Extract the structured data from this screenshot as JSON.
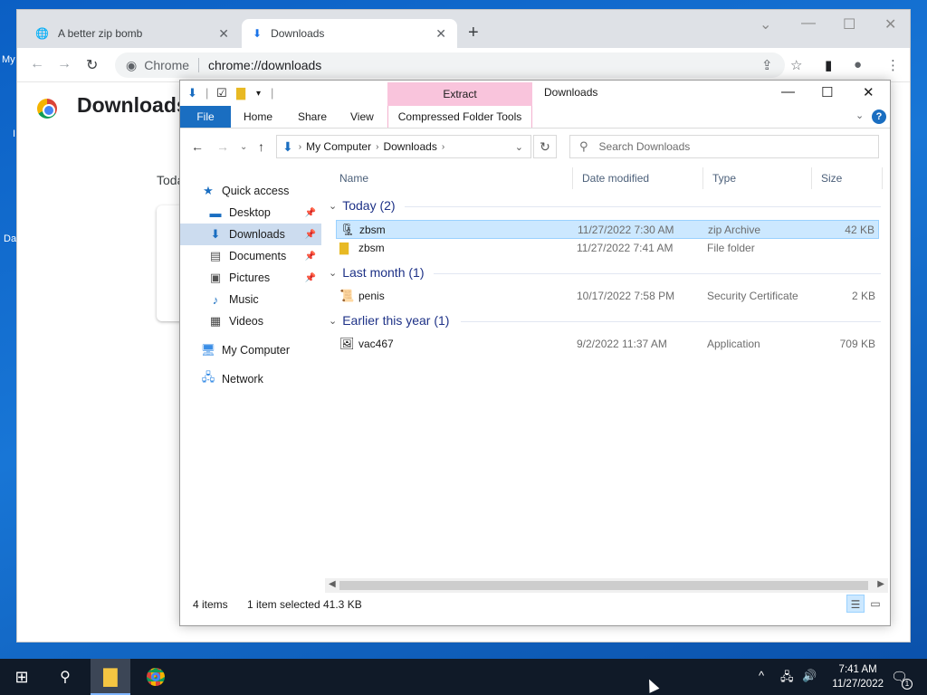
{
  "desktop": {
    "frag1": "My",
    "frag2": "Da"
  },
  "chrome": {
    "tabs": [
      {
        "title": "A better zip bomb",
        "icon": "globe-icon"
      },
      {
        "title": "Downloads",
        "icon": "download-icon"
      }
    ],
    "omnibox_chip": "Chrome",
    "url": "chrome://downloads",
    "page_title": "Downloads",
    "today_fragment": "Toda"
  },
  "explorer": {
    "title": "Downloads",
    "context_group": "Extract",
    "ribbon_tabs": {
      "file": "File",
      "home": "Home",
      "share": "Share",
      "view": "View",
      "context": "Compressed Folder Tools"
    },
    "breadcrumb": [
      "My Computer",
      "Downloads"
    ],
    "search_placeholder": "Search Downloads",
    "nav": {
      "quick_access": "Quick access",
      "desktop": "Desktop",
      "downloads": "Downloads",
      "documents": "Documents",
      "pictures": "Pictures",
      "music": "Music",
      "videos": "Videos",
      "my_computer": "My Computer",
      "network": "Network"
    },
    "columns": {
      "name": "Name",
      "date": "Date modified",
      "type": "Type",
      "size": "Size"
    },
    "groups": [
      {
        "label": "Today (2)",
        "files": [
          {
            "name": "zbsm",
            "date": "11/27/2022 7:30 AM",
            "type": "zip Archive",
            "size": "42 KB",
            "icon": "zip-icon",
            "selected": true
          },
          {
            "name": "zbsm",
            "date": "11/27/2022 7:41 AM",
            "type": "File folder",
            "size": "",
            "icon": "folder-icon",
            "selected": false
          }
        ]
      },
      {
        "label": "Last month (1)",
        "files": [
          {
            "name": "penis",
            "date": "10/17/2022 7:58 PM",
            "type": "Security Certificate",
            "size": "2 KB",
            "icon": "certificate-icon",
            "selected": false
          }
        ]
      },
      {
        "label": "Earlier this year (1)",
        "files": [
          {
            "name": "vac467",
            "date": "9/2/2022 11:37 AM",
            "type": "Application",
            "size": "709 KB",
            "icon": "application-icon",
            "selected": false
          }
        ]
      }
    ],
    "status": {
      "items": "4 items",
      "selected": "1 item selected",
      "size": "41.3 KB"
    }
  },
  "taskbar": {
    "time": "7:41 AM",
    "date": "11/27/2022",
    "notifications": "1"
  }
}
